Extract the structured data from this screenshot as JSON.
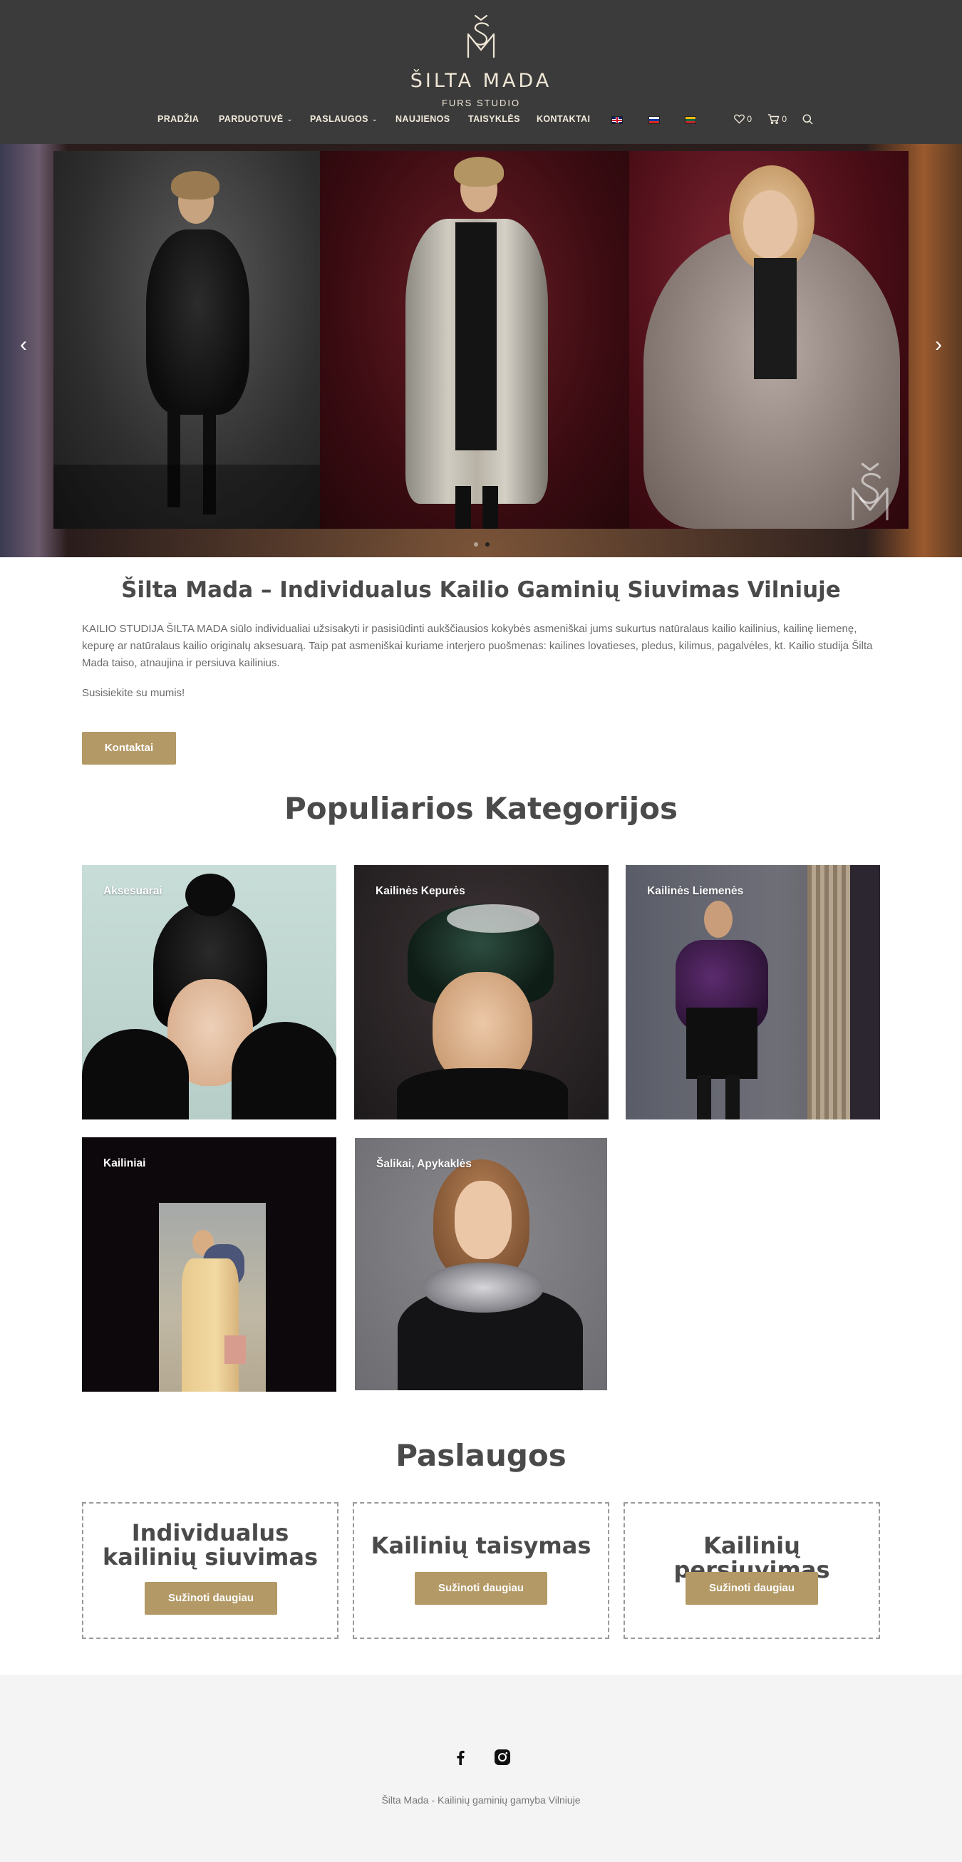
{
  "header": {
    "brand_name": "ŠILTA MADA",
    "brand_sub": "FURS STUDIO",
    "nav": [
      {
        "label": "PRADŽIA"
      },
      {
        "label": "PARDUOTUVĖ"
      },
      {
        "label": "PASLAUGOS"
      },
      {
        "label": "NAUJIENOS"
      },
      {
        "label": "TAISYKLĖS"
      },
      {
        "label": "KONTAKTAI"
      }
    ],
    "languages": [
      "en-flag-icon",
      "ru-flag-icon",
      "lt-flag-icon"
    ],
    "wishlist_count": "0",
    "cart_count": "0"
  },
  "hero": {
    "prev_arrow": "‹",
    "next_arrow": "›",
    "slide_count": 2,
    "active_slide": 2
  },
  "intro": {
    "title": "Šilta Mada – Individualus Kailio Gaminių Siuvimas Vilniuje",
    "paragraph": "KAILIO STUDIJA ŠILTA MADA siūlo individualiai užsisakyti ir pasisiūdinti aukščiausios kokybės asmeniškai jums sukurtus natūralaus kailio kailinius, kailinę liemenę, kepurę ar natūralaus kailio originalų aksesuarą. Taip pat asmeniškai kuriame interjero puošmenas: kailines lovatieses, pledus, kilimus, pagalvėles, kt. Kailio studija Šilta Mada taiso, atnaujina ir persiuva kailinius.",
    "cta_text": "Susisiekite su mumis!",
    "button_label": "Kontaktai"
  },
  "categories": {
    "title": "Populiarios Kategorijos",
    "items": [
      {
        "label": "Aksesuarai"
      },
      {
        "label": "Kailinės Kepurės"
      },
      {
        "label": "Kailinės Liemenės"
      },
      {
        "label": "Kailiniai"
      },
      {
        "label": "Šalikai, Apykaklės"
      }
    ]
  },
  "services": {
    "title": "Paslaugos",
    "items": [
      {
        "title": "Individualus kailinių siuvimas",
        "button": "Sužinoti daugiau"
      },
      {
        "title": "Kailinių taisymas",
        "button": "Sužinoti daugiau"
      },
      {
        "title": "Kailinių persiuvimas",
        "button": "Sužinoti daugiau"
      }
    ]
  },
  "footer": {
    "social": [
      "facebook-icon",
      "instagram-icon"
    ],
    "text": "Šilta Mada - Kailinių gaminių gamyba Vilniuje"
  },
  "colors": {
    "header_bg": "#3b3b3b",
    "accent": "#b39966",
    "nav_text": "#f1eadb",
    "footer_bg": "#f4f4f4"
  }
}
